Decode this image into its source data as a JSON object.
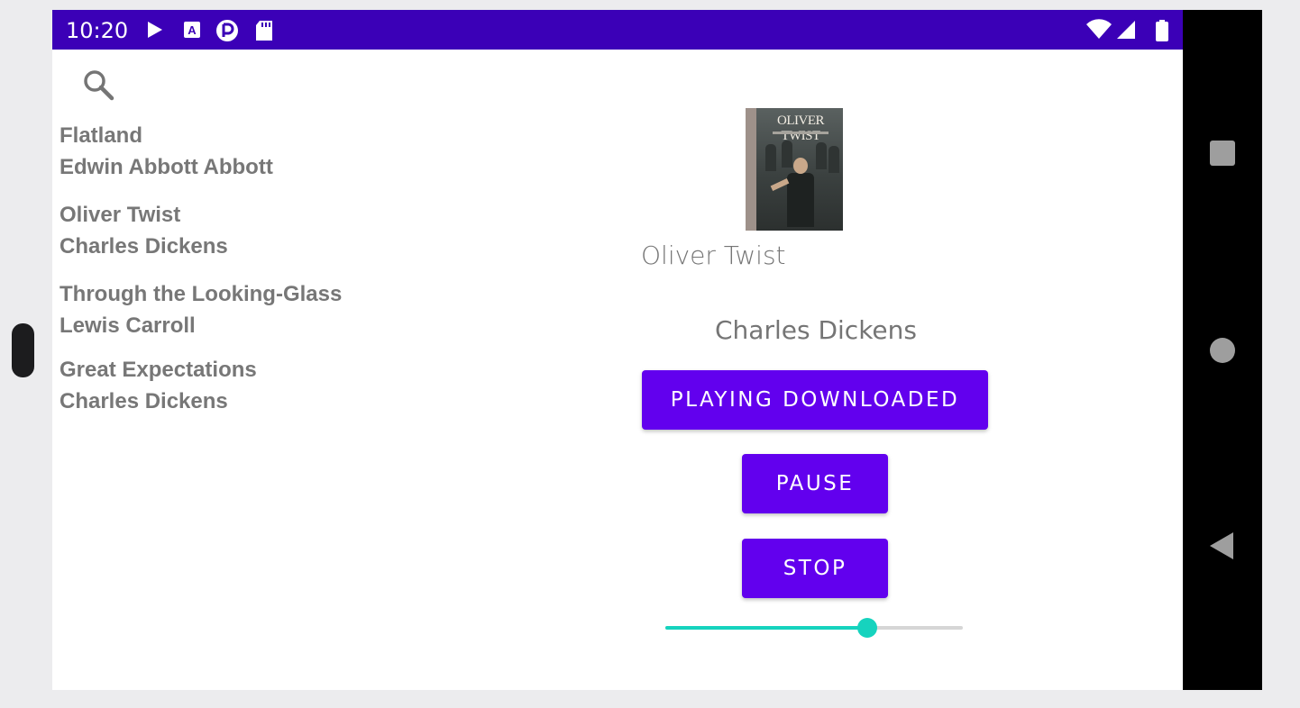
{
  "status_bar": {
    "time": "10:20",
    "icons": [
      "play-store-icon",
      "a-icon",
      "p-icon",
      "sd-card-icon",
      "wifi-icon",
      "signal-icon",
      "battery-icon"
    ]
  },
  "nav_bar": {
    "buttons": [
      "recents-icon",
      "home-icon",
      "back-icon"
    ]
  },
  "search": {
    "icon": "search-icon"
  },
  "books": [
    {
      "title": "Flatland",
      "author": "Edwin Abbott Abbott"
    },
    {
      "title": "Oliver Twist",
      "author": "Charles Dickens"
    },
    {
      "title": "Through the Looking-Glass",
      "author": "Lewis Carroll"
    },
    {
      "title": "Great Expectations",
      "author": "Charles Dickens"
    }
  ],
  "detail": {
    "cover_title": "OLIVER TWIST",
    "title": "Oliver Twist",
    "author": "Charles Dickens",
    "buttons": {
      "playing": "PLAYING DOWNLOADED",
      "pause": "PAUSE",
      "stop": "STOP"
    },
    "progress": 0.68
  },
  "colors": {
    "status_bar": "#3b00b7",
    "button": "#6200ee",
    "slider_accent": "#16d3be",
    "text_gray": "#777777"
  }
}
